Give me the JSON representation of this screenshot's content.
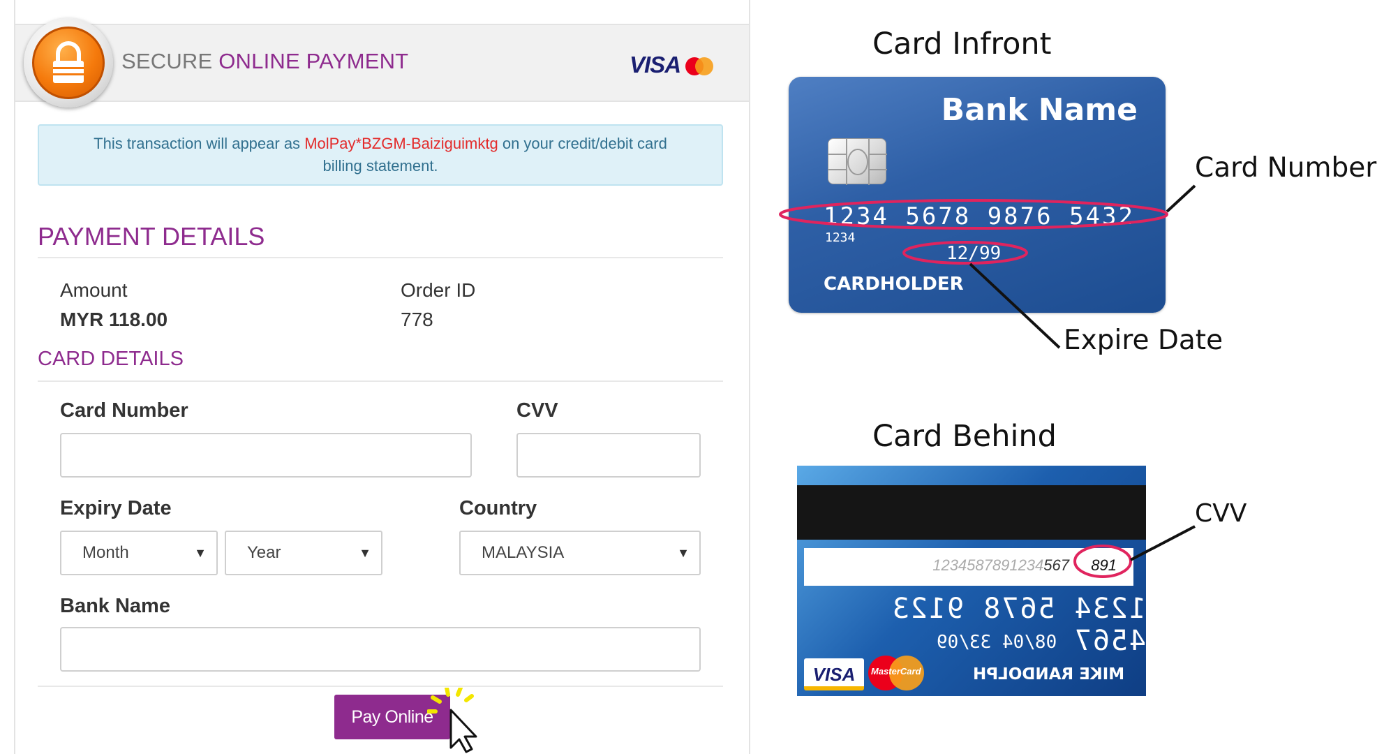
{
  "header": {
    "title_part1": "SECURE",
    "title_part2": "ONLINE PAYMENT",
    "visa_label": "VISA"
  },
  "notice": {
    "prefix": "This transaction will appear as",
    "merchant": "MolPay*BZGM-Baiziguimktg",
    "suffix_line1": "on your credit/debit card",
    "line2": "billing statement."
  },
  "payment_details": {
    "title": "PAYMENT DETAILS",
    "amount_label": "Amount",
    "amount_value": "MYR 118.00",
    "order_label": "Order ID",
    "order_value": "778"
  },
  "card_details": {
    "title": "CARD DETAILS",
    "card_number_label": "Card Number",
    "card_number_value": "",
    "cvv_label": "CVV",
    "cvv_value": "",
    "expiry_label": "Expiry Date",
    "month_selected": "Month",
    "year_selected": "Year",
    "country_label": "Country",
    "country_selected": "MALAYSIA",
    "bank_label": "Bank Name",
    "bank_value": ""
  },
  "pay_button": "Pay Online",
  "explainer": {
    "front_caption": "Card Infront",
    "behind_caption": "Card Behind",
    "card_number_caption": "Card Number",
    "expire_caption": "Expire Date",
    "cvv_caption": "CVV",
    "front": {
      "bank_name": "Bank Name",
      "number": "1234 5678 9876 5432",
      "small_number": "1234",
      "valid_thru": "12/99",
      "holder": "CARDHOLDER"
    },
    "back": {
      "sig_light": "1234587891234",
      "sig_dark": "567",
      "cvv": "891",
      "number": "1234 5678 9123 4567",
      "dates": "08/04   33/09",
      "name": "MIKE RANDOLPH",
      "visa": "VISA",
      "mastercard": "MasterCard"
    }
  },
  "colors": {
    "brand_purple": "#8e2b8e",
    "notice_bg": "#dff1f8",
    "merchant_red": "#e32b2b",
    "highlight_pink": "#e0245e"
  }
}
